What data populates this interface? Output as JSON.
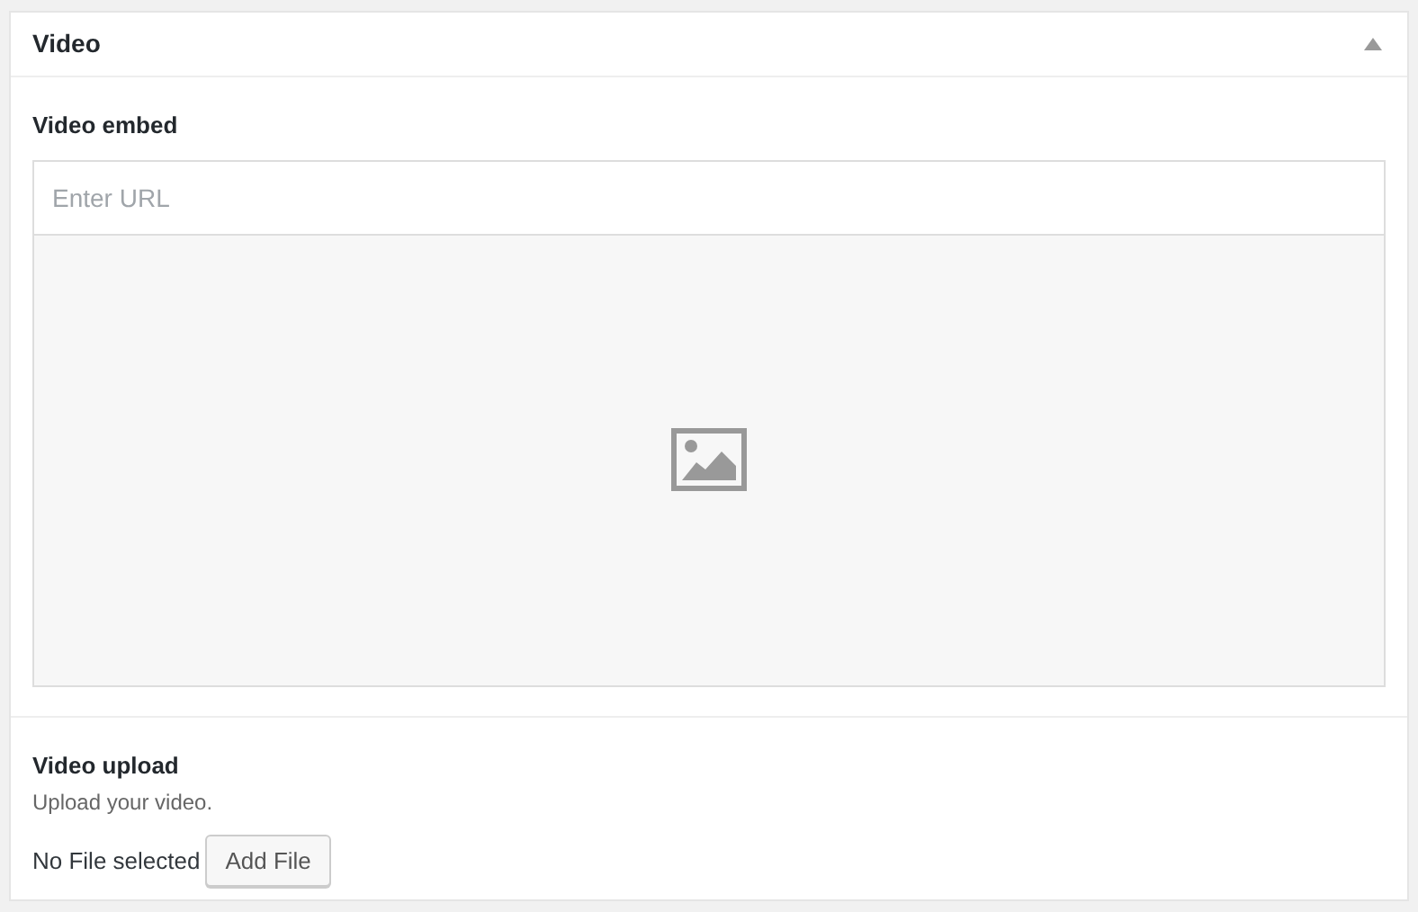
{
  "panel": {
    "title": "Video",
    "expanded": true
  },
  "embed": {
    "label": "Video embed",
    "placeholder": "Enter URL"
  },
  "upload": {
    "label": "Video upload",
    "description": "Upload your video.",
    "file_status": "No File selected",
    "button": "Add File"
  }
}
